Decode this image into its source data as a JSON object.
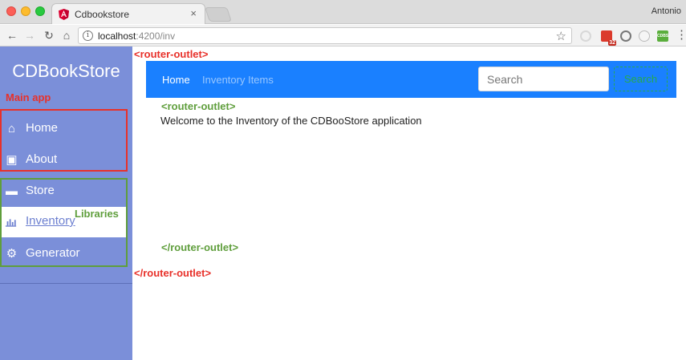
{
  "browser": {
    "tab_title": "Cdbookstore",
    "tab_close": "×",
    "profile_name": "Antonio",
    "url_host": "localhost",
    "url_path": ":4200/inv",
    "info_glyph": "i",
    "star_glyph": "☆",
    "menu_glyph": "⋮",
    "back_glyph": "←",
    "forward_glyph": "→",
    "reload_glyph": "↻",
    "home_glyph": "⌂",
    "ext_badge": "32",
    "ext_text": "CDBS",
    "icons": [
      "angular-favicon-icon",
      "back-icon",
      "forward-icon",
      "reload-icon",
      "home-icon",
      "info-icon",
      "star-icon",
      "menu-icon"
    ]
  },
  "sidebar": {
    "brand": "CDBookStore",
    "items": [
      {
        "label": "Home",
        "icon": "home-icon",
        "glyph": "⌂"
      },
      {
        "label": "About",
        "icon": "briefcase-icon",
        "glyph": "▣"
      },
      {
        "label": "Store",
        "icon": "store-icon",
        "glyph": "▬"
      },
      {
        "label": "Inventory",
        "icon": "bar-chart-icon",
        "glyph": "▮"
      },
      {
        "label": "Generator",
        "icon": "cogs-icon",
        "glyph": "⚙"
      }
    ]
  },
  "annotations": {
    "main_app": "Main app",
    "libraries": "Libraries",
    "outlet_open": "<router-outlet>",
    "outlet_close": "</router-outlet>",
    "inner_outlet_open": "<router-outlet>",
    "inner_outlet_close": "</router-outlet>"
  },
  "navbar": {
    "home": "Home",
    "inventory_items": "Inventory Items",
    "search_placeholder": "Search",
    "search_button": "Search"
  },
  "content": {
    "welcome": "Welcome to the Inventory of the CDBooStore application"
  },
  "colors": {
    "sidebar": "#7b8fd9",
    "navbar": "#1a80ff",
    "annotation_red": "#e8312a",
    "annotation_green": "#5f9e3c",
    "search_button": "#26a94f"
  }
}
